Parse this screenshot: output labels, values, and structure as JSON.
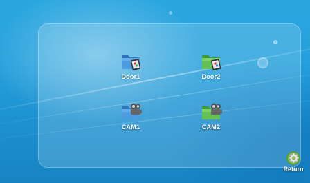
{
  "tiles": [
    {
      "label": "Door1",
      "icon": "blue-video-folder-icon"
    },
    {
      "label": "Door2",
      "icon": "green-video-folder-icon"
    },
    {
      "label": "CAM1",
      "icon": "blue-camera-folder-icon"
    },
    {
      "label": "CAM2",
      "icon": "green-camera-folder-icon"
    }
  ],
  "return_button": {
    "label": "Return",
    "icon": "gear-icon"
  },
  "colors": {
    "background": "#25a0dc",
    "folder_blue": "#3f8fd6",
    "folder_green": "#5cbb4a",
    "label_text": "#ffffff"
  }
}
